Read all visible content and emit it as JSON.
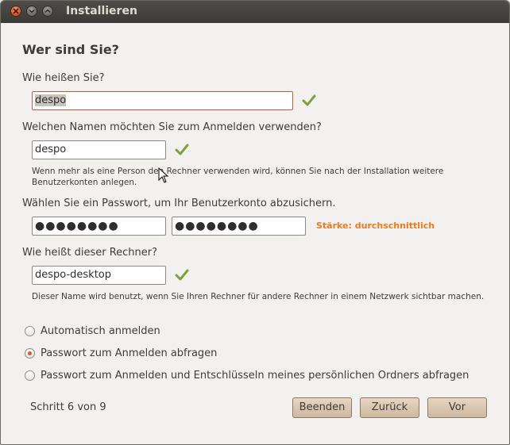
{
  "window": {
    "title": "Installieren"
  },
  "form": {
    "heading": "Wer sind Sie?",
    "name_label": "Wie heißen Sie?",
    "name_value": "despo",
    "login_label": "Welchen Namen möchten Sie zum Anmelden verwenden?",
    "login_value": "despo",
    "login_note": "Wenn mehr als eine Person den Rechner verwenden wird, können Sie nach der Installation weitere Benutzerkonten anlegen.",
    "password_label": "Wählen Sie ein Passwort, um Ihr Benutzerkonto abzusichern.",
    "password_value": "●●●●●●●●",
    "password_confirm_value": "●●●●●●●●",
    "strength_text": "Stärke: durchschnittlich",
    "computer_label": "Wie heißt dieser Rechner?",
    "computer_value": "despo-desktop",
    "computer_note": "Dieser Name wird benutzt, wenn Sie Ihren Rechner für andere Rechner in einem Netzwerk sichtbar machen.",
    "options": [
      {
        "label": "Automatisch anmelden",
        "checked": false
      },
      {
        "label": "Passwort zum Anmelden abfragen",
        "checked": true
      },
      {
        "label": "Passwort zum Anmelden und Entschlüsseln meines persönlichen Ordners abfragen",
        "checked": false
      }
    ]
  },
  "footer": {
    "step_text": "Schritt 6 von 9",
    "quit_label": "Beenden",
    "back_label": "Zurück",
    "forward_label": "Vor"
  },
  "colors": {
    "accent": "#e35a21",
    "strength": "#f07a1a",
    "check": "#7aa33b"
  }
}
